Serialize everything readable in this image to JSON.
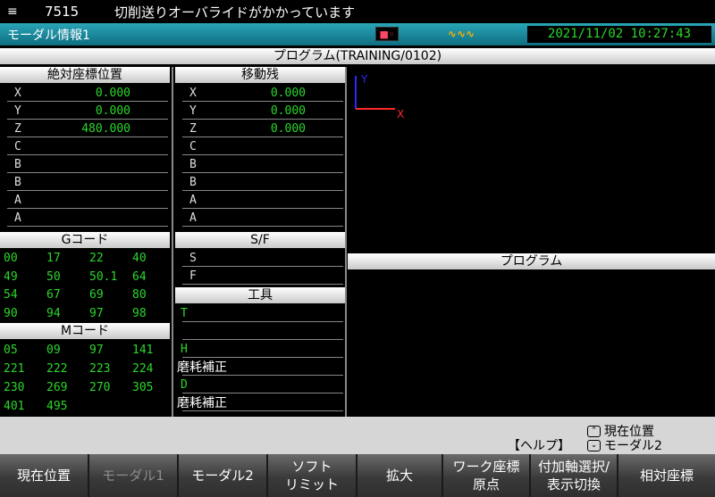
{
  "alarm": {
    "icon": "alarm-list-icon",
    "code": "7515",
    "message": "切削送りオーバライドがかかっています"
  },
  "title_bar": {
    "title": "モーダル情報1",
    "tool_icon": "tool-status-icon",
    "signal_icon": "spindle-signal-icon",
    "datetime": "2021/11/02 10:27:43"
  },
  "program_title": "プログラム(TRAINING/0102)",
  "program_lower_header": "プログラム",
  "plot": {
    "y_label": "Y",
    "x_label": "X",
    "colors": {
      "y_axis": "#2a2aff",
      "x_axis": "#ff2a2a"
    }
  },
  "absolute_position": {
    "header": "絶対座標位置",
    "rows": [
      {
        "axis": "X",
        "value": "0.000"
      },
      {
        "axis": "Y",
        "value": "0.000"
      },
      {
        "axis": "Z",
        "value": "480.000"
      },
      {
        "axis": "C",
        "value": ""
      },
      {
        "axis": "B",
        "value": ""
      },
      {
        "axis": "B",
        "value": ""
      },
      {
        "axis": "A",
        "value": ""
      },
      {
        "axis": "A",
        "value": ""
      }
    ]
  },
  "distance_to_go": {
    "header": "移動残",
    "rows": [
      {
        "axis": "X",
        "value": "0.000"
      },
      {
        "axis": "Y",
        "value": "0.000"
      },
      {
        "axis": "Z",
        "value": "0.000"
      },
      {
        "axis": "C",
        "value": ""
      },
      {
        "axis": "B",
        "value": ""
      },
      {
        "axis": "B",
        "value": ""
      },
      {
        "axis": "A",
        "value": ""
      },
      {
        "axis": "A",
        "value": ""
      }
    ]
  },
  "g_code": {
    "header": "Gコード",
    "rows": [
      [
        "00",
        "17",
        "22",
        "40"
      ],
      [
        "49",
        "50",
        "50.1",
        "64"
      ],
      [
        "54",
        "67",
        "69",
        "80"
      ],
      [
        "90",
        "94",
        "97",
        "98"
      ]
    ]
  },
  "m_code": {
    "header": "Mコード",
    "rows": [
      [
        "05",
        "09",
        "97",
        "141"
      ],
      [
        "221",
        "222",
        "223",
        "224"
      ],
      [
        "230",
        "269",
        "270",
        "305"
      ],
      [
        "401",
        "495",
        "",
        ""
      ]
    ]
  },
  "sf": {
    "header": "S/F",
    "s": "S",
    "f": "F"
  },
  "tool": {
    "header": "工具",
    "t": "T",
    "h": "H",
    "h_comp": "磨耗補正",
    "d": "D",
    "d_comp": "磨耗補正"
  },
  "help": {
    "help_label": "【ヘルプ】",
    "option_up": "現在位置",
    "option_down": "モーダル2",
    "up_icon": "chevron-up-icon",
    "down_icon": "chevron-down-icon"
  },
  "softkeys": [
    {
      "l1": "現在位置",
      "l2": ""
    },
    {
      "l1": "モーダル1",
      "l2": ""
    },
    {
      "l1": "モーダル2",
      "l2": ""
    },
    {
      "l1": "ソフト",
      "l2": "リミット"
    },
    {
      "l1": "拡大",
      "l2": ""
    },
    {
      "l1": "ワーク座標",
      "l2": "原点"
    },
    {
      "l1": "付加軸選択/",
      "l2": "表示切換"
    },
    {
      "l1": "相対座標",
      "l2": ""
    }
  ]
}
